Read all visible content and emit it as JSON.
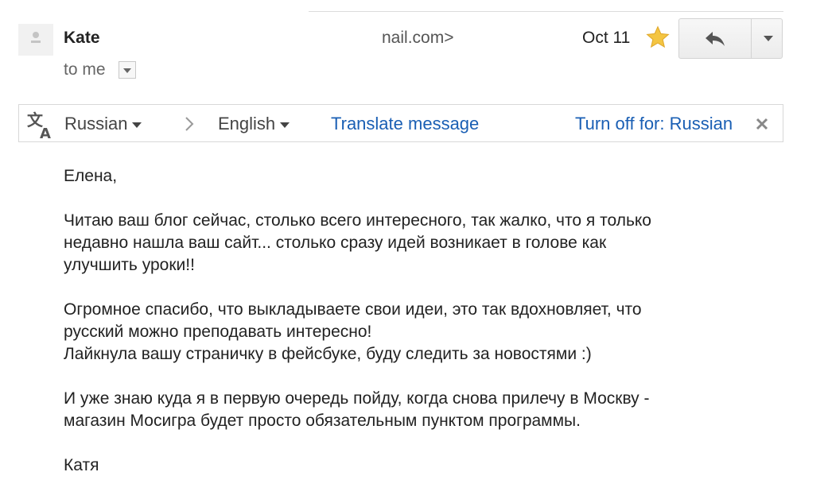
{
  "header": {
    "sender_name": "Kate",
    "sender_email_fragment": "nail.com>",
    "date": "Oct 11",
    "recipient_label": "to me",
    "starred": true,
    "star_color": "#f4c542"
  },
  "translate_bar": {
    "source_language": "Russian",
    "target_language": "English",
    "translate_label": "Translate message",
    "turn_off_label": "Turn off for: Russian"
  },
  "message": {
    "greeting": "Елена,",
    "paragraph_1": "Читаю ваш блог сейчас, столько всего интересного, так жалко, что я только\nнедавно нашла ваш сайт... столько сразу идей возникает в голове как\nулучшить уроки!!",
    "paragraph_2": "Огромное спасибо, что выкладываете свои идеи, это так вдохновляет, что\nрусский можно преподавать интересно!\nЛайкнула вашу страничку в фейсбуке, буду следить за новостями :)",
    "paragraph_3": "И уже знаю куда я в первую очередь пойду, когда снова прилечу в Москву -\nмагазин Мосигра будет просто обязательным пунктом программы.",
    "signature": "Катя"
  },
  "colors": {
    "link": "#1a5fb4",
    "border": "#d8d8d8"
  }
}
